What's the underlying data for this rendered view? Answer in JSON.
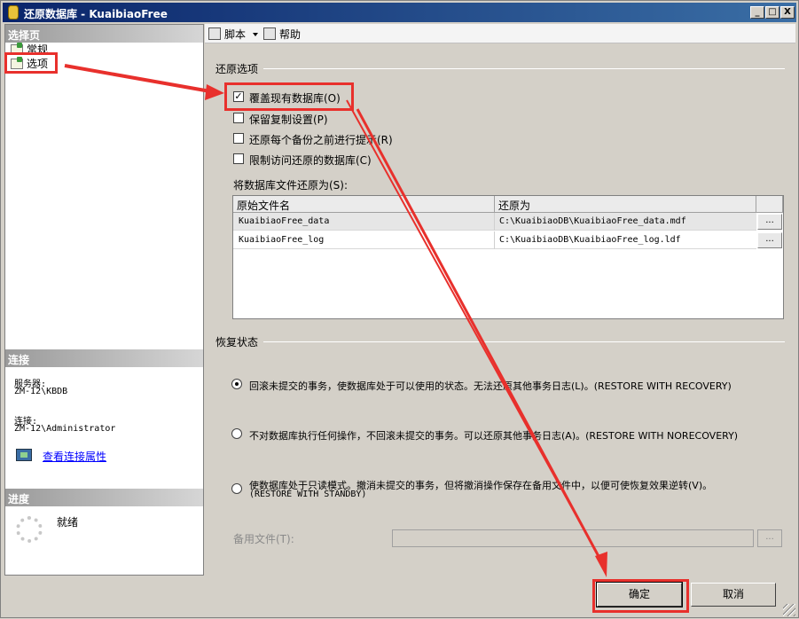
{
  "window": {
    "title": "还原数据库 - KuaibiaoFree",
    "min": "_",
    "max": "□",
    "close": "X"
  },
  "left": {
    "select_page_header": "选择页",
    "nav": [
      {
        "label": "常规"
      },
      {
        "label": "选项"
      }
    ],
    "connection_header": "连接",
    "server_label": "服务器:",
    "server_value": "ZM-12\\KBDB",
    "conn_label": "连接:",
    "conn_value": "ZM-12\\Administrator",
    "conn_link": "查看连接属性",
    "progress_header": "进度",
    "progress_status": "就绪"
  },
  "toolbar": {
    "script": "脚本",
    "help": "帮助"
  },
  "restore_options": {
    "title": "还原选项",
    "checks": [
      {
        "label": "覆盖现有数据库(O)",
        "checked": true
      },
      {
        "label": "保留复制设置(P)",
        "checked": false
      },
      {
        "label": "还原每个备份之前进行提示(R)",
        "checked": false
      },
      {
        "label": "限制访问还原的数据库(C)",
        "checked": false
      }
    ],
    "files_label": "将数据库文件还原为(S):",
    "columns": [
      "原始文件名",
      "还原为"
    ],
    "rows": [
      {
        "original": "KuaibiaoFree_data",
        "restore_as": "C:\\KuaibiaoDB\\KuaibiaoFree_data.mdf"
      },
      {
        "original": "KuaibiaoFree_log",
        "restore_as": "C:\\KuaibiaoDB\\KuaibiaoFree_log.ldf"
      }
    ],
    "ellipsis": "..."
  },
  "recovery": {
    "title": "恢复状态",
    "options": [
      {
        "label": "回滚未提交的事务，使数据库处于可以使用的状态。无法还原其他事务日志(L)。(RESTORE WITH RECOVERY)",
        "selected": true
      },
      {
        "label": "不对数据库执行任何操作，不回滚未提交的事务。可以还原其他事务日志(A)。(RESTORE WITH NORECOVERY)",
        "selected": false
      },
      {
        "label": "使数据库处于只读模式。撤消未提交的事务，但将撤消操作保存在备用文件中，以便可使恢复效果逆转(V)。",
        "label2": "(RESTORE WITH STANDBY)",
        "selected": false
      }
    ],
    "standby_label": "备用文件(T):",
    "standby_value": "",
    "standby_btn": "..."
  },
  "buttons": {
    "ok": "确定",
    "cancel": "取消"
  },
  "colors": {
    "annotation": "#e8302c",
    "title_start": "#0a246a",
    "title_end": "#3a6ea5"
  }
}
